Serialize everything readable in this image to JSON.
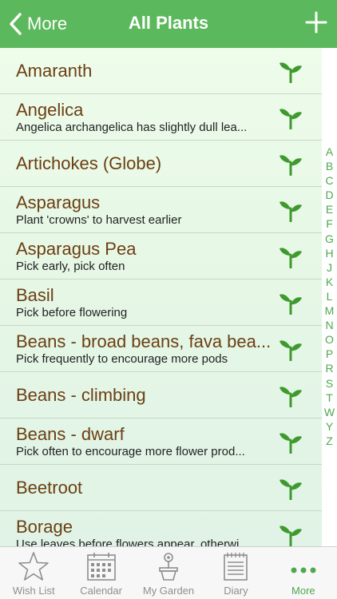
{
  "nav": {
    "back_label": "More",
    "title": "All Plants"
  },
  "plants": [
    {
      "name": "Amaranth",
      "note": ""
    },
    {
      "name": "Angelica",
      "note": "Angelica archangelica has slightly dull lea..."
    },
    {
      "name": "Artichokes (Globe)",
      "note": ""
    },
    {
      "name": "Asparagus",
      "note": "Plant 'crowns' to harvest earlier"
    },
    {
      "name": "Asparagus Pea",
      "note": "Pick early, pick often"
    },
    {
      "name": "Basil",
      "note": "Pick before flowering"
    },
    {
      "name": "Beans - broad beans, fava bea...",
      "note": "Pick frequently to encourage more pods"
    },
    {
      "name": "Beans - climbing",
      "note": ""
    },
    {
      "name": "Beans - dwarf",
      "note": "Pick often to encourage more flower prod..."
    },
    {
      "name": "Beetroot",
      "note": ""
    },
    {
      "name": "Borage",
      "note": "Use leaves before flowers appear, otherwi..."
    }
  ],
  "index_letters": [
    "A",
    "B",
    "C",
    "D",
    "E",
    "F",
    "G",
    "H",
    "J",
    "K",
    "L",
    "M",
    "N",
    "O",
    "P",
    "R",
    "S",
    "T",
    "W",
    "Y",
    "Z"
  ],
  "tabs": [
    {
      "label": "Wish List",
      "icon": "star-icon",
      "active": false
    },
    {
      "label": "Calendar",
      "icon": "calendar-icon",
      "active": false
    },
    {
      "label": "My Garden",
      "icon": "flowerpot-icon",
      "active": false
    },
    {
      "label": "Diary",
      "icon": "notebook-icon",
      "active": false
    },
    {
      "label": "More",
      "icon": "more-dots-icon",
      "active": true
    }
  ],
  "colors": {
    "nav_bar": "#5cb85c",
    "plant_name": "#6b3f12",
    "accent": "#4fa84f",
    "sprout_icon": "#3f9a2e"
  }
}
